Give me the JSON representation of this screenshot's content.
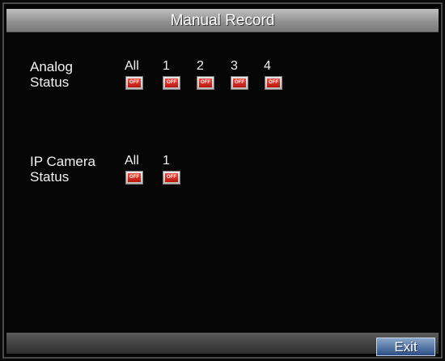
{
  "dialog": {
    "title": "Manual Record"
  },
  "analog": {
    "label_line1": "Analog",
    "label_line2": "Status",
    "columns": [
      "All",
      "1",
      "2",
      "3",
      "4"
    ],
    "states": [
      "OFF",
      "OFF",
      "OFF",
      "OFF",
      "OFF"
    ]
  },
  "ip_camera": {
    "label_line1": "IP Camera",
    "label_line2": "Status",
    "columns": [
      "All",
      "1"
    ],
    "states": [
      "OFF",
      "OFF"
    ]
  },
  "footer": {
    "exit_label": "Exit"
  },
  "colors": {
    "off_toggle": "#d0261d",
    "exit_button": "#3f6aa8",
    "title_bar": "#a6a6a6"
  }
}
